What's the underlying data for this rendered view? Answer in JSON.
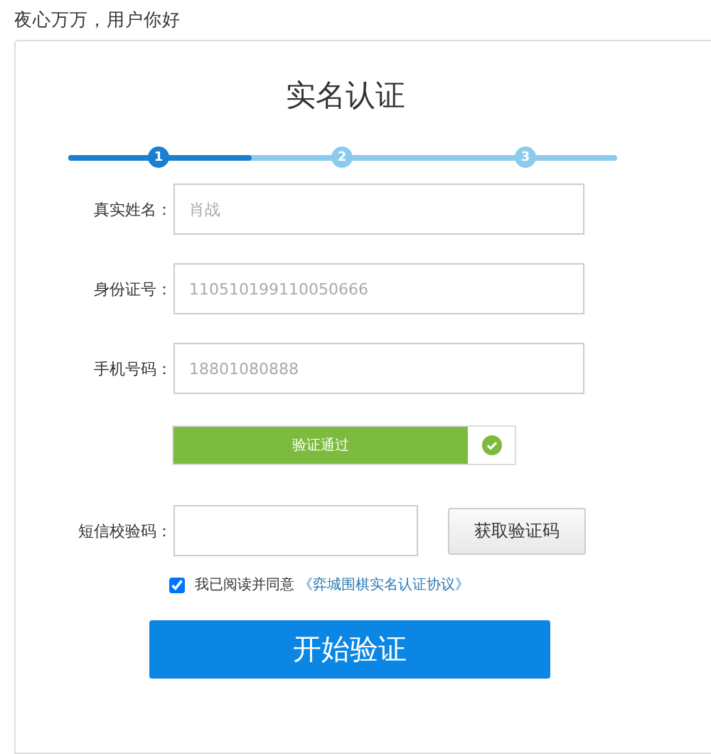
{
  "greeting": "夜心万万，用户你好",
  "title": "实名认证",
  "stepper": {
    "level": 0.335,
    "steps": [
      {
        "label": "1",
        "selected": true
      },
      {
        "label": "2",
        "selected": false
      },
      {
        "label": "3",
        "selected": false
      }
    ]
  },
  "fields": [
    {
      "label": "真实姓名：",
      "placeholder": "肖战"
    },
    {
      "label": "身份证号：",
      "placeholder": "110510199110050666"
    },
    {
      "label": "手机号码：",
      "placeholder": "18801080888"
    }
  ],
  "verification": {
    "text": "验证通过",
    "verified": true
  },
  "sms": {
    "label": "短信校验码：",
    "button": "获取验证码"
  },
  "agreement": {
    "checked": true,
    "text": "我已阅读并同意",
    "link": "《弈城围棋实名认证协议》"
  },
  "submit": "开始验证"
}
